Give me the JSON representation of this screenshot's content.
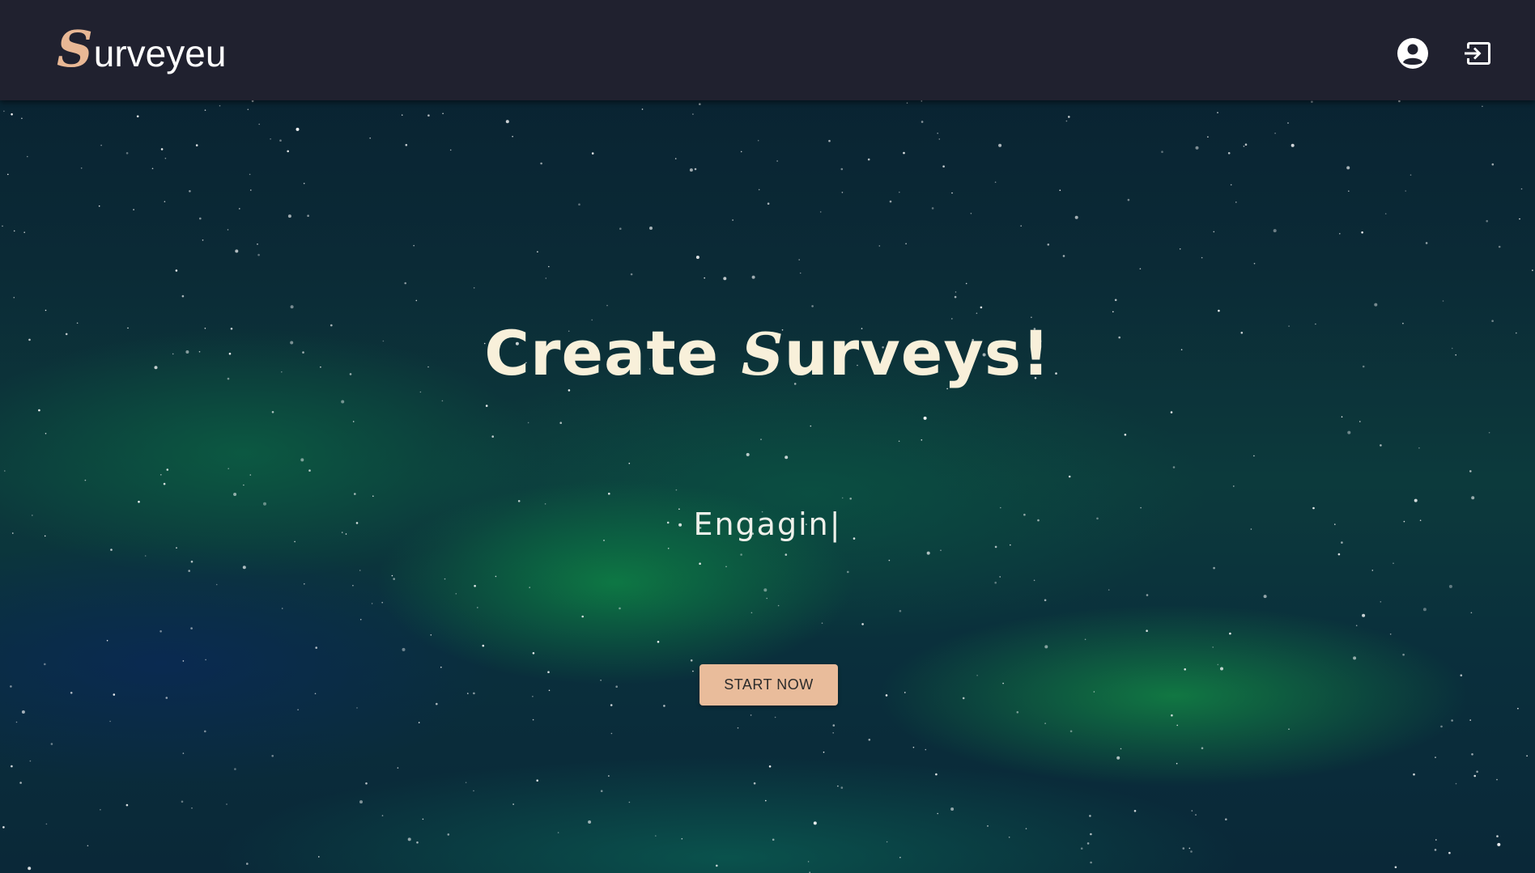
{
  "navbar": {
    "brand": {
      "initial": "S",
      "rest": "urveyeu"
    },
    "icons": {
      "account": "account-circle-icon",
      "login": "login-icon"
    }
  },
  "hero": {
    "headline": {
      "before": "Create ",
      "initial": "S",
      "after": "urveys!"
    },
    "typed_text": "Engagin",
    "cursor": "|",
    "cta_label": "START NOW"
  },
  "colors": {
    "navbar_bg": "#20212f",
    "brand_accent": "#e9b895",
    "headline_text": "#f8f0da",
    "cta_bg": "#e9bc9b"
  }
}
